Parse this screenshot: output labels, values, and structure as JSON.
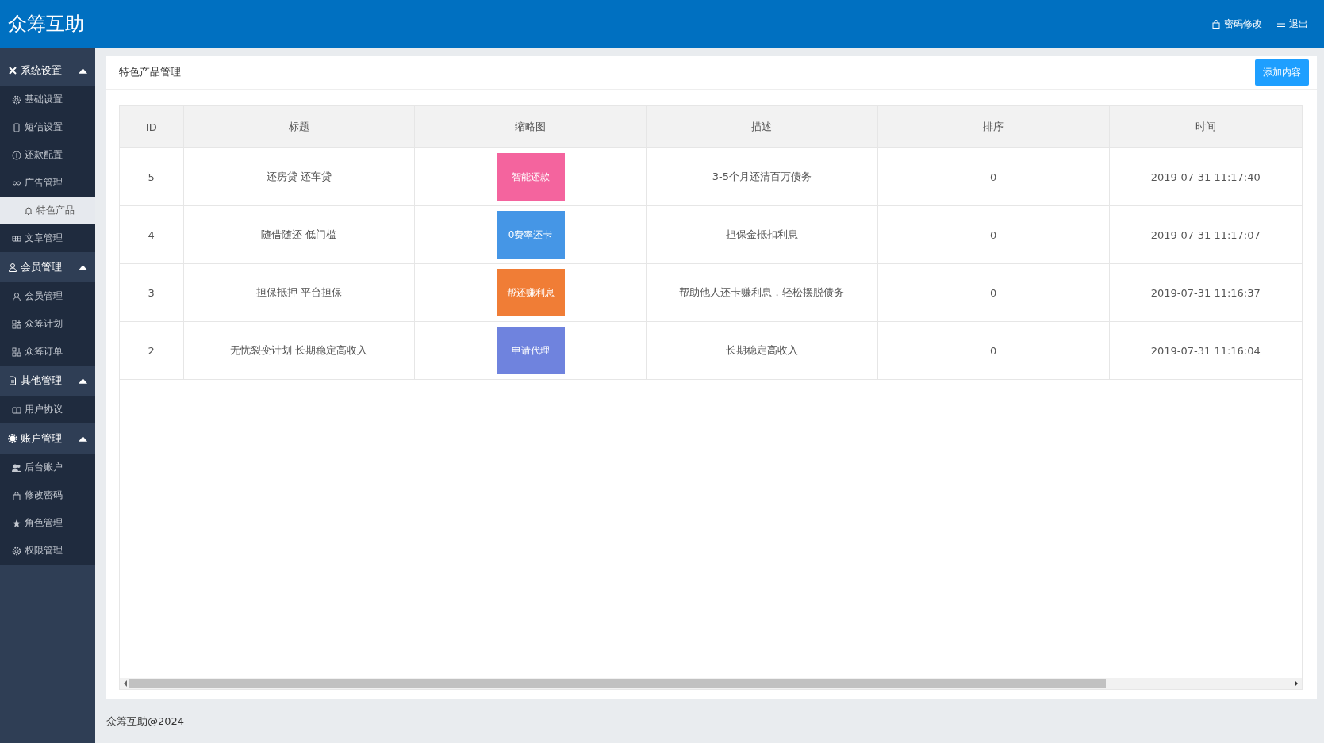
{
  "header": {
    "logo": "众筹互助",
    "actions": [
      "密码修改",
      "退出"
    ]
  },
  "sidebar": [
    {
      "title": "系统设置",
      "expanded": true,
      "items": [
        {
          "label": "基础设置",
          "selected": false
        },
        {
          "label": "短信设置",
          "selected": false
        },
        {
          "label": "还款配置",
          "selected": false
        },
        {
          "label": "广告管理",
          "selected": false
        },
        {
          "label": "特色产品",
          "selected": true
        },
        {
          "label": "文章管理",
          "selected": false
        }
      ]
    },
    {
      "title": "会员管理",
      "expanded": true,
      "items": [
        {
          "label": "会员管理",
          "selected": false
        },
        {
          "label": "众筹计划",
          "selected": false
        },
        {
          "label": "众筹订单",
          "selected": false
        }
      ]
    },
    {
      "title": "其他管理",
      "expanded": true,
      "items": [
        {
          "label": "用户协议",
          "selected": false
        }
      ]
    },
    {
      "title": "账户管理",
      "expanded": true,
      "items": [
        {
          "label": "后台账户",
          "selected": false
        },
        {
          "label": "修改密码",
          "selected": false
        },
        {
          "label": "角色管理",
          "selected": false
        },
        {
          "label": "权限管理",
          "selected": false
        }
      ]
    }
  ],
  "panel": {
    "title": "特色产品管理",
    "add_button": "添加内容"
  },
  "table": {
    "columns": [
      "ID",
      "标题",
      "缩略图",
      "描述",
      "排序",
      "时间"
    ],
    "rows": [
      {
        "id": "5",
        "title": "还房贷 还车贷",
        "thumbnail": "智能还款",
        "color": "#f4649e",
        "description": "3-5个月还清百万债务",
        "sort": "0",
        "time": "2019-07-31 11:17:40"
      },
      {
        "id": "4",
        "title": "随借随还 低门槛",
        "thumbnail": "0费率还卡",
        "color": "#4596e6",
        "description": "担保金抵扣利息",
        "sort": "0",
        "time": "2019-07-31 11:17:07"
      },
      {
        "id": "3",
        "title": "担保抵押 平台担保",
        "thumbnail": "帮还赚利息",
        "color": "#f07d36",
        "description": "帮助他人还卡赚利息，轻松摆脱债务",
        "sort": "0",
        "time": "2019-07-31 11:16:37"
      },
      {
        "id": "2",
        "title": "无忧裂变计划 长期稳定高收入",
        "thumbnail": "申请代理",
        "color": "#6f83de",
        "description": "长期稳定高收入",
        "sort": "0",
        "time": "2019-07-31 11:16:04"
      }
    ]
  },
  "footer": "众筹互助@2024"
}
